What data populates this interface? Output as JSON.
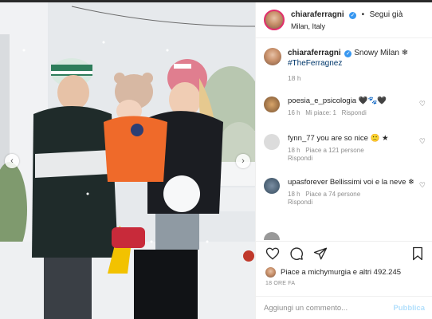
{
  "post": {
    "username": "chiaraferragni",
    "follow_label": "Segui già",
    "location": "Milan, Italy"
  },
  "caption": {
    "username": "chiaraferragni",
    "text": "Snowy Milan ❄",
    "hashtag": "#TheFerragnez",
    "time": "18 h"
  },
  "comments": [
    {
      "username": "poesia_e_psicologia",
      "text": "🖤🐾🖤",
      "time": "16 h",
      "likes": "Mi piace: 1",
      "reply": "Rispondi"
    },
    {
      "username": "fynn_77",
      "text": "you are so nice 🙂 ★",
      "time": "18 h",
      "likes": "Piace a 121 persone",
      "reply": "Rispondi"
    },
    {
      "username": "upasforever",
      "text": "Bellissimi voi e la neve ❄",
      "time": "18 h",
      "likes": "Piace a 74 persone",
      "reply": "Rispondi"
    }
  ],
  "likes_text": "Piace a michymurgia e altri 492.245",
  "timestamp": "18 ORE FA",
  "comment_input": {
    "placeholder": "Aggiungi un commento..."
  },
  "publish_label": "Pubblica",
  "icons": [
    "heart-icon",
    "comment-icon",
    "share-icon",
    "bookmark-icon"
  ],
  "colors": {
    "link": "#00376b",
    "verified": "#3897f0",
    "publish": "#b2dffc",
    "meta": "#8e8e8e"
  }
}
